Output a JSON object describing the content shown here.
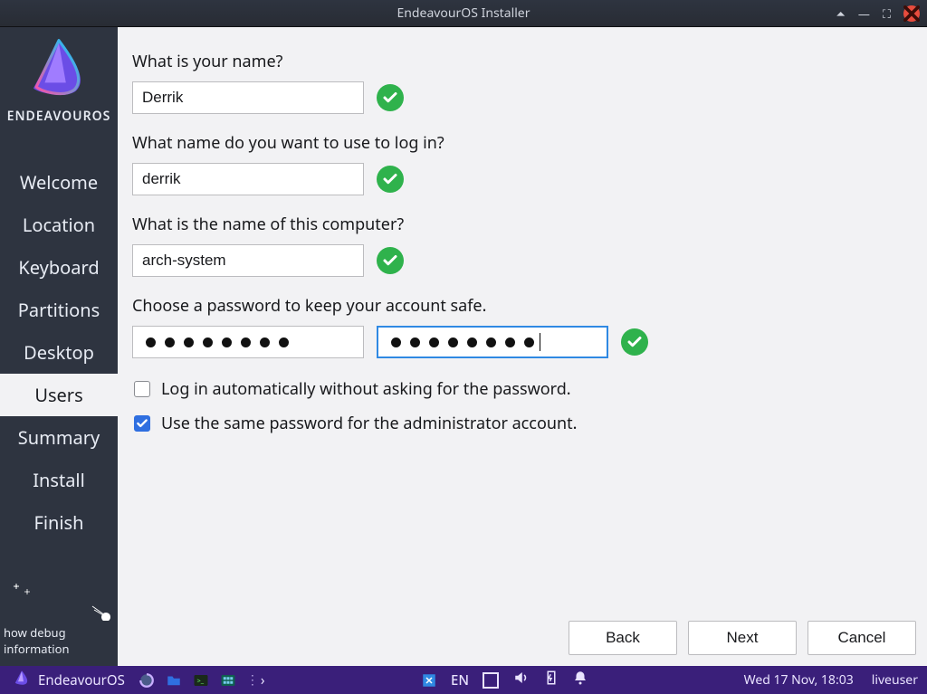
{
  "window": {
    "title": "EndeavourOS Installer"
  },
  "sidebar": {
    "brand": "ENDEAVOUROS",
    "steps": [
      {
        "label": "Welcome"
      },
      {
        "label": "Location"
      },
      {
        "label": "Keyboard"
      },
      {
        "label": "Partitions"
      },
      {
        "label": "Desktop"
      },
      {
        "label": "Users"
      },
      {
        "label": "Summary"
      },
      {
        "label": "Install"
      },
      {
        "label": "Finish"
      }
    ],
    "active_index": 5,
    "debug_label": "how debug information"
  },
  "form": {
    "name_label": "What is your name?",
    "name_value": "Derrik",
    "login_label": "What name do you want to use to log in?",
    "login_value": "derrik",
    "computer_label": "What is the name of this computer?",
    "computer_value": "arch-system",
    "password_label": "Choose a password to keep your account safe.",
    "autologin_label": "Log in automatically without asking for the password.",
    "autologin_checked": false,
    "samepw_label": "Use the same password for the administrator account.",
    "samepw_checked": true
  },
  "buttons": {
    "back": "Back",
    "next": "Next",
    "cancel": "Cancel"
  },
  "taskbar": {
    "app": "EndeavourOS",
    "lang": "EN",
    "datetime": "Wed 17 Nov, 18:03",
    "user": "liveuser"
  }
}
